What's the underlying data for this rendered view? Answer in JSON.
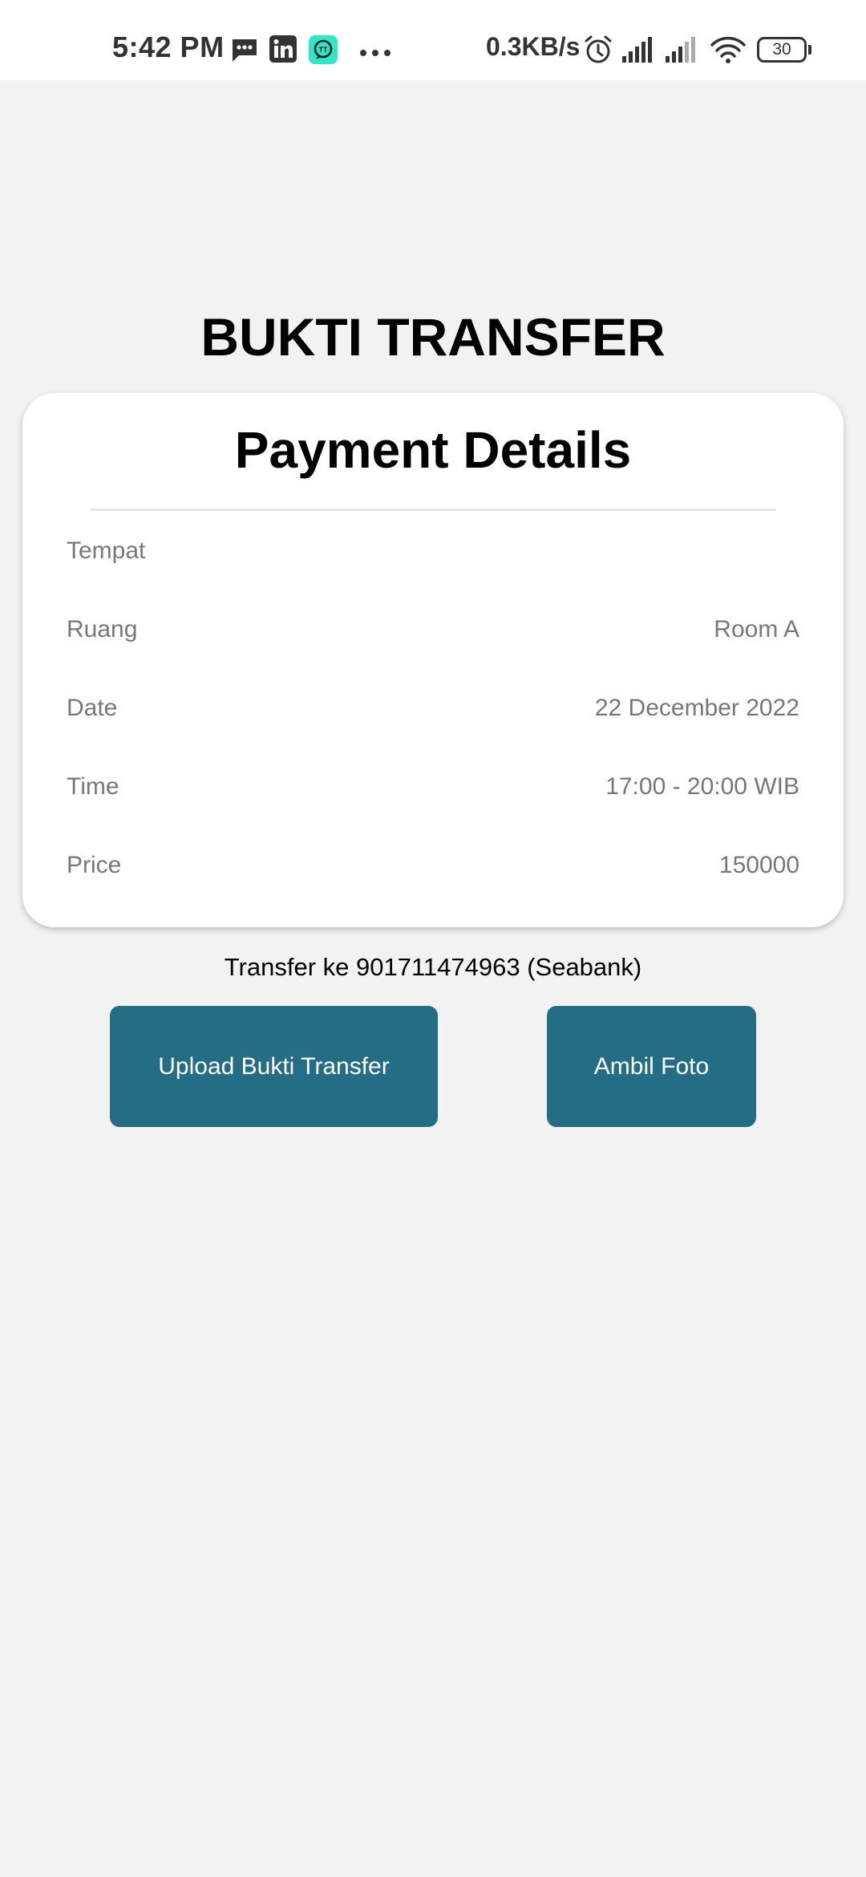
{
  "status_bar": {
    "time": "5:42 PM",
    "network_speed": "0.3KB/s",
    "battery_level": "30",
    "icons": [
      "message-icon",
      "linkedin-icon",
      "app-notification-icon",
      "more-dots-icon",
      "alarm-icon",
      "signal-icon",
      "signal-icon",
      "wifi-icon",
      "battery-icon"
    ]
  },
  "page": {
    "title": "BUKTI TRANSFER"
  },
  "card": {
    "title": "Payment Details",
    "rows": [
      {
        "label": "Tempat",
        "value": ""
      },
      {
        "label": "Ruang",
        "value": "Room A"
      },
      {
        "label": "Date",
        "value": "22 December 2022"
      },
      {
        "label": "Time",
        "value": "17:00 - 20:00 WIB"
      },
      {
        "label": "Price",
        "value": "150000"
      }
    ]
  },
  "transfer_note": "Transfer ke 901711474963 (Seabank)",
  "buttons": {
    "upload_label": "Upload Bukti Transfer",
    "photo_label": "Ambil Foto"
  },
  "colors": {
    "background": "#f2f2f2",
    "button": "#236e84",
    "card": "#ffffff",
    "muted_text": "#777777"
  }
}
